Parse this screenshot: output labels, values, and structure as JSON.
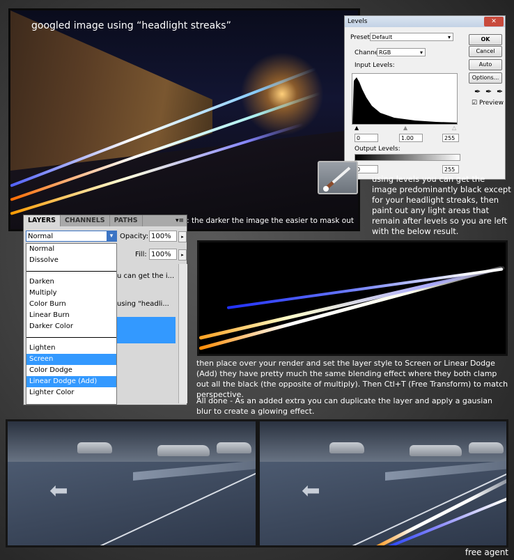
{
  "top_photo": {
    "caption": "googled image using “headlight streaks”",
    "tip": "tip: the darker the image the easier to mask out"
  },
  "levels": {
    "title": "Levels",
    "close": "✕",
    "preset_label": "Preset:",
    "preset_value": "Default",
    "channel_label": "Channel:",
    "channel_value": "RGB",
    "input_levels_label": "Input Levels:",
    "input_values": [
      "0",
      "1.00",
      "255"
    ],
    "output_levels_label": "Output Levels:",
    "output_values": [
      "0",
      "255"
    ],
    "buttons": {
      "ok": "OK",
      "cancel": "Cancel",
      "auto": "Auto",
      "options": "Options..."
    },
    "preview_label": "Preview",
    "preview_checked": true
  },
  "text_levels": "using levels you can get the image predominantly black except for your headlight streaks, then paint out any light areas that remain after levels so you are left with the below result.",
  "layers_panel": {
    "tabs": [
      "LAYERS",
      "CHANNELS",
      "PATHS"
    ],
    "blend_mode": "Normal",
    "opacity_label": "Opacity:",
    "opacity_value": "100%",
    "fill_label": "Fill:",
    "fill_value": "100%",
    "partial_text_1": "u can get the i...",
    "partial_text_2": "using \"headli...",
    "options_group1": [
      "Normal",
      "Dissolve"
    ],
    "options_group2": [
      "Darken",
      "Multiply",
      "Color Burn",
      "Linear Burn",
      "Darker Color"
    ],
    "options_group3": [
      "Lighten",
      "Screen",
      "Color Dodge",
      "Linear Dodge (Add)",
      "Lighter Color"
    ],
    "highlighted": [
      "Screen",
      "Linear Dodge (Add)"
    ]
  },
  "text_blend": "then place over your render and set the layer style to Screen or Linear Dodge (Add) they have pretty much the same blending effect where they both clamp out all the black (the opposite of multiply). Then Ctl+T (Free Transform) to match perspective.",
  "text_done": "All done - As an added extra you can duplicate the layer and apply a gausian blur to create a glowing effect.",
  "signature": "free agent"
}
